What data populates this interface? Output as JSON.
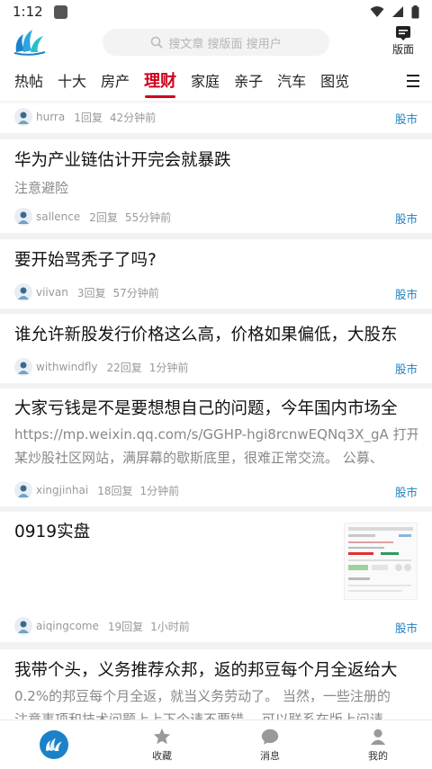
{
  "status_bar": {
    "time": "1:12"
  },
  "search": {
    "placeholder": "搜文章 搜版面 搜用户"
  },
  "header": {
    "layout_label": "版面"
  },
  "tabs": [
    "热帖",
    "十大",
    "房产",
    "理财",
    "家庭",
    "亲子",
    "汽车",
    "图览"
  ],
  "active_tab": "理财",
  "posts": [
    {
      "title": "",
      "excerpt": "",
      "user": "hurra",
      "replies": "1回复",
      "time": "42分钟前",
      "category": "股市"
    },
    {
      "title": "华为产业链估计开完会就暴跌",
      "excerpt": "注意避险",
      "user": "sallence",
      "replies": "2回复",
      "time": "55分钟前",
      "category": "股市"
    },
    {
      "title": "要开始骂秃子了吗?",
      "excerpt": "",
      "user": "viivan",
      "replies": "3回复",
      "time": "57分钟前",
      "category": "股市"
    },
    {
      "title": "谁允许新股发行价格这么高，价格如果偏低，大股东",
      "excerpt": "",
      "user": "withwindfly",
      "replies": "22回复",
      "time": "1分钟前",
      "category": "股市"
    },
    {
      "title": "大家亏钱是不是要想想自己的问题，今年国内市场全",
      "excerpt_line1": "https://mp.weixin.qq.com/s/GGHP-hgi8rcnwEQNq3X_gA 打开",
      "excerpt_line2": "某炒股社区网站，满屏幕的歇斯底里，很难正常交流。 公募、",
      "user": "xingjinhai",
      "replies": "18回复",
      "time": "1分钟前",
      "category": "股市"
    },
    {
      "title": "0919实盘",
      "excerpt": "",
      "user": "aiqingcome",
      "replies": "19回复",
      "time": "1小时前",
      "category": "股市"
    },
    {
      "title": "我带个头，义务推荐众邦，返的邦豆每个月全返给大",
      "excerpt_line1": "0.2%的邦豆每个月全返，就当义务劳动了。 当然，一些注册的",
      "excerpt_line2": "注意事项和技术问题上上下个请不要错。 可以联系在版上问请",
      "user": "",
      "replies": "",
      "time": "",
      "category": ""
    }
  ],
  "bottom_nav": {
    "favorites": "收藏",
    "messages": "消息",
    "mine": "我的"
  },
  "colors": {
    "accent": "#d0021b",
    "link": "#1a7fc1",
    "brand": "#1b82c9"
  }
}
